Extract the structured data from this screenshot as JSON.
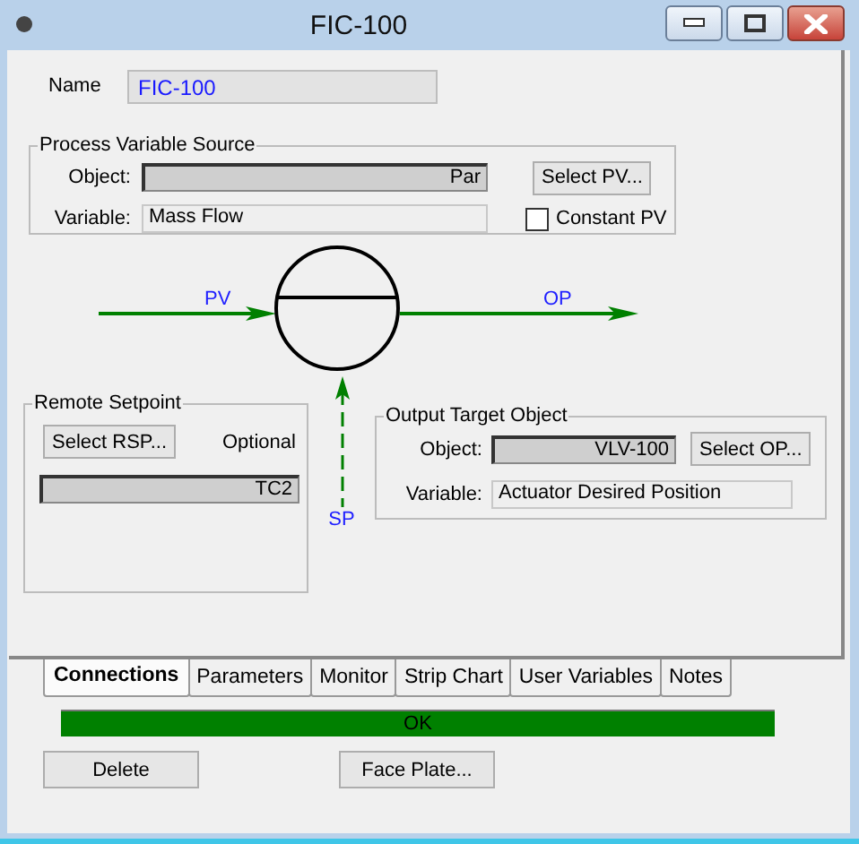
{
  "window": {
    "title": "FIC-100"
  },
  "name": {
    "label": "Name",
    "value": "FIC-100"
  },
  "pv_source": {
    "title": "Process Variable Source",
    "object_label": "Object:",
    "object_value": "Par",
    "variable_label": "Variable:",
    "variable_value": "Mass Flow",
    "select_button": "Select PV...",
    "constant_pv": {
      "label": "Constant PV",
      "checked": false
    }
  },
  "diagram": {
    "pv_label": "PV",
    "op_label": "OP",
    "sp_label": "SP"
  },
  "remote_setpoint": {
    "title": "Remote Setpoint",
    "select_button": "Select RSP...",
    "note": "Optional",
    "value": "TC2"
  },
  "output_target": {
    "title": "Output Target Object",
    "object_label": "Object:",
    "object_value": "VLV-100",
    "select_button": "Select OP...",
    "variable_label": "Variable:",
    "variable_value": "Actuator Desired Position"
  },
  "tabs": [
    {
      "label": "Connections",
      "selected": true
    },
    {
      "label": "Parameters",
      "selected": false
    },
    {
      "label": "Monitor",
      "selected": false
    },
    {
      "label": "Strip Chart",
      "selected": false
    },
    {
      "label": "User Variables",
      "selected": false
    },
    {
      "label": "Notes",
      "selected": false
    }
  ],
  "status": {
    "text": "OK",
    "kind": "ok"
  },
  "buttons": [
    "Delete",
    "Face Plate..."
  ]
}
